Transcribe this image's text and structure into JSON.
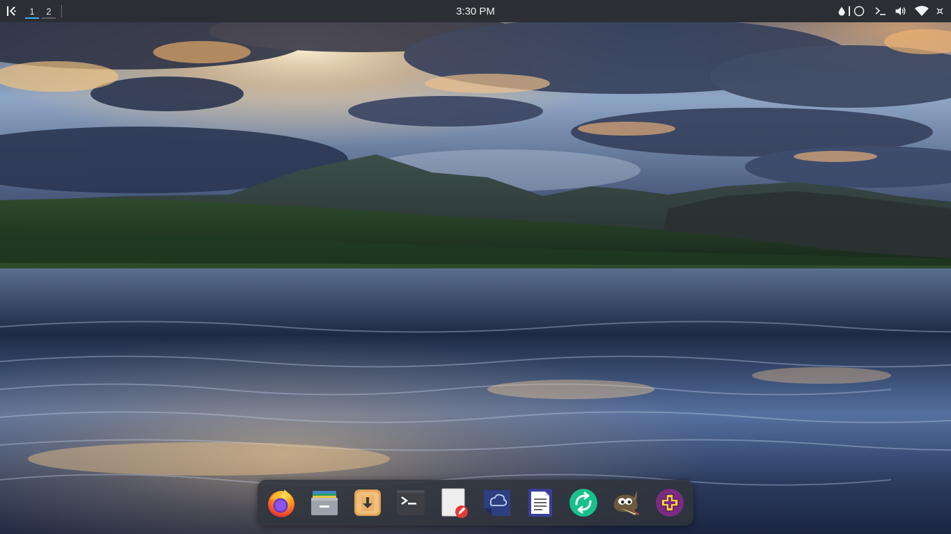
{
  "panel": {
    "virtual_desktops": [
      {
        "label": "1",
        "active": true
      },
      {
        "label": "2",
        "active": false
      }
    ],
    "clock": "3:30 PM",
    "tray_icons": [
      "drop-icon",
      "circle-icon",
      "terminal-icon",
      "volume-icon",
      "wifi-icon"
    ]
  },
  "dock": {
    "apps": [
      "firefox-icon",
      "file-manager-icon",
      "download-manager-icon",
      "terminal-icon",
      "text-editor-icon",
      "cloud-sync-icon",
      "document-viewer-icon",
      "sync-app-icon",
      "gimp-icon",
      "plus-app-icon"
    ]
  },
  "colors": {
    "panel_bg": "#2b2e33",
    "accent": "#3daee9",
    "dock_bg": "#30343c"
  }
}
